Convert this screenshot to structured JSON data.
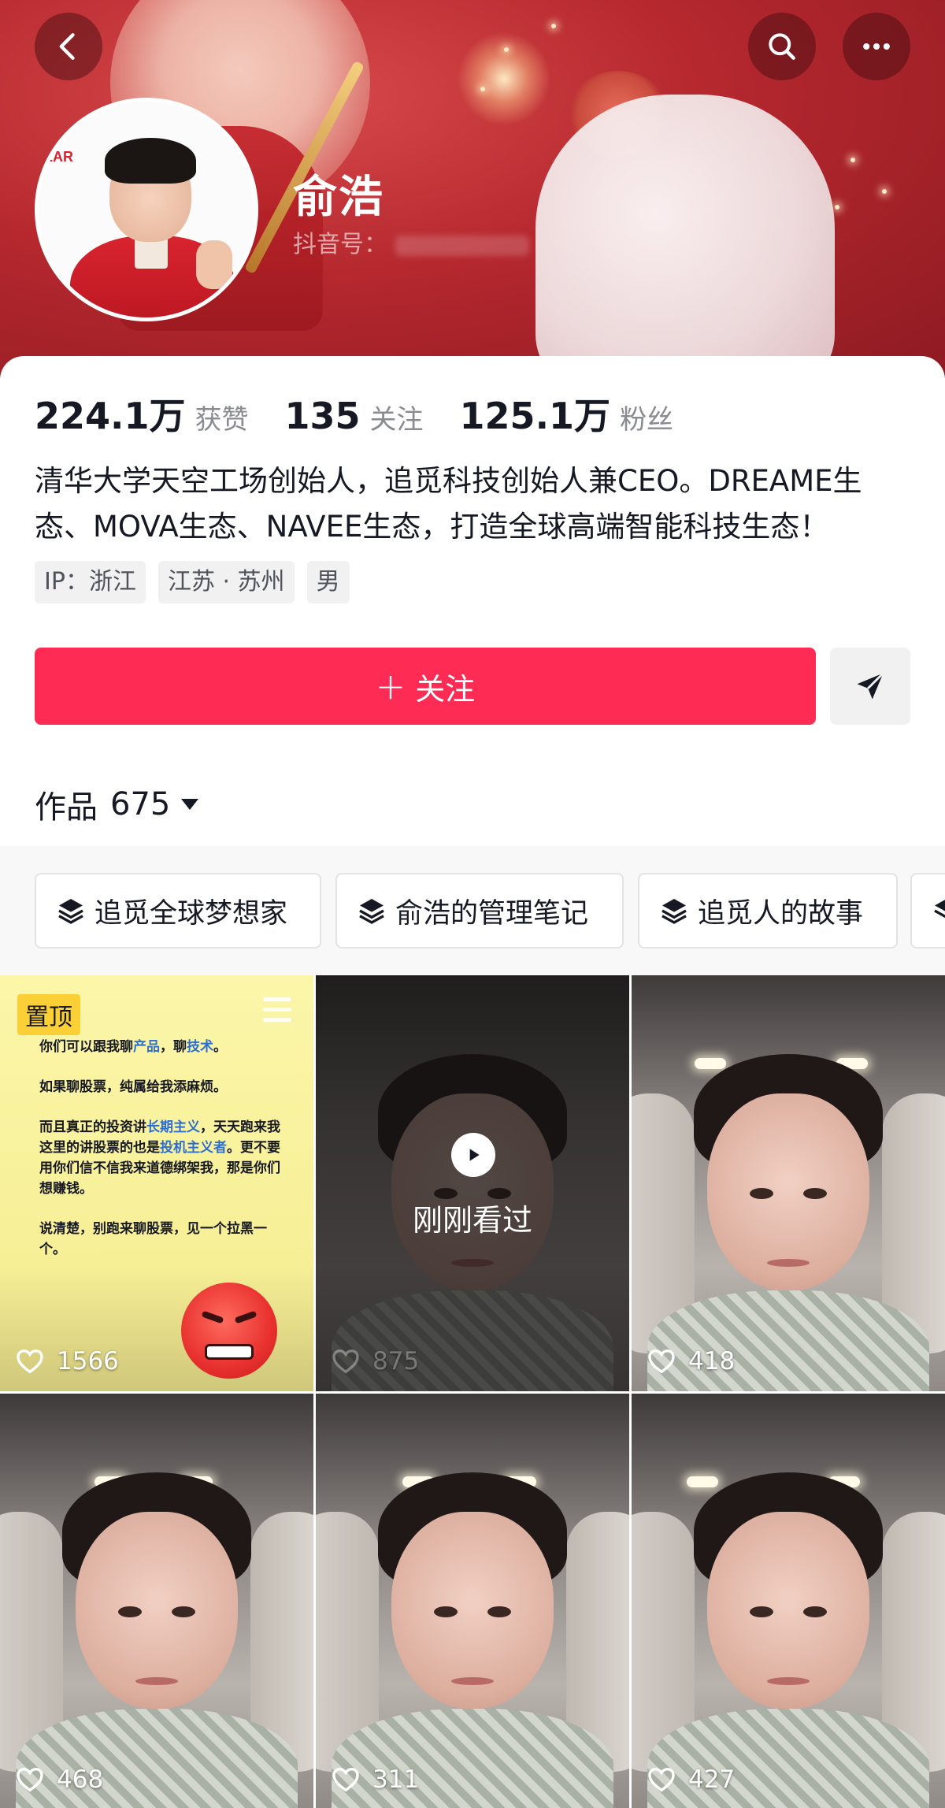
{
  "header": {
    "back_icon": "chevron-left-icon",
    "search_icon": "search-icon",
    "more_icon": "more-dots-icon",
    "username": "俞浩",
    "id_label": "抖音号：",
    "avatar_badge_text": "EAR"
  },
  "stats": [
    {
      "value": "224.1万",
      "label": "获赞"
    },
    {
      "value": "135",
      "label": "关注"
    },
    {
      "value": "125.1万",
      "label": "粉丝"
    }
  ],
  "bio": {
    "line1": "清华大学天空工场创始人，追觅科技创始人兼CEO。DREAME生",
    "line2": "态、MOVA生态、NAVEE生态，打造全球高端智能科技生态！"
  },
  "tags": [
    "IP：浙江",
    "江苏 · 苏州",
    "男"
  ],
  "actions": {
    "follow_label": "关注",
    "follow_plus": "+",
    "share_icon": "send-icon",
    "accent": "#fe2c55"
  },
  "works": {
    "label": "作品",
    "count": "675"
  },
  "collections": [
    {
      "label": "追觅全球梦想家",
      "icon": "layers-icon"
    },
    {
      "label": "俞浩的管理笔记",
      "icon": "layers-icon"
    },
    {
      "label": "追觅人的故事",
      "icon": "layers-icon"
    }
  ],
  "videos": [
    {
      "likes": "1566",
      "pinned_label": "置顶",
      "card_text": {
        "p1_a": "你们可以跟我聊",
        "p1_b": "产品",
        "p1_c": "，聊",
        "p1_d": "技术",
        "p1_e": "。",
        "p2": "如果聊股票，纯属给我添麻烦。",
        "p3_a": "而且真正的投资讲",
        "p3_b": "长期主义",
        "p3_c": "，天天跑来我这里的讲股票的也是",
        "p3_d": "投机主义者",
        "p3_e": "。更不要用你们信不信我来道德绑架我，那是你们想赚钱。",
        "p4": "说清楚，别跑来聊股票，见一个拉黑一个。"
      }
    },
    {
      "likes": "875",
      "overlay_label": "刚刚看过"
    },
    {
      "likes": "418"
    },
    {
      "likes": "468"
    },
    {
      "likes": "311"
    },
    {
      "likes": "427"
    }
  ]
}
